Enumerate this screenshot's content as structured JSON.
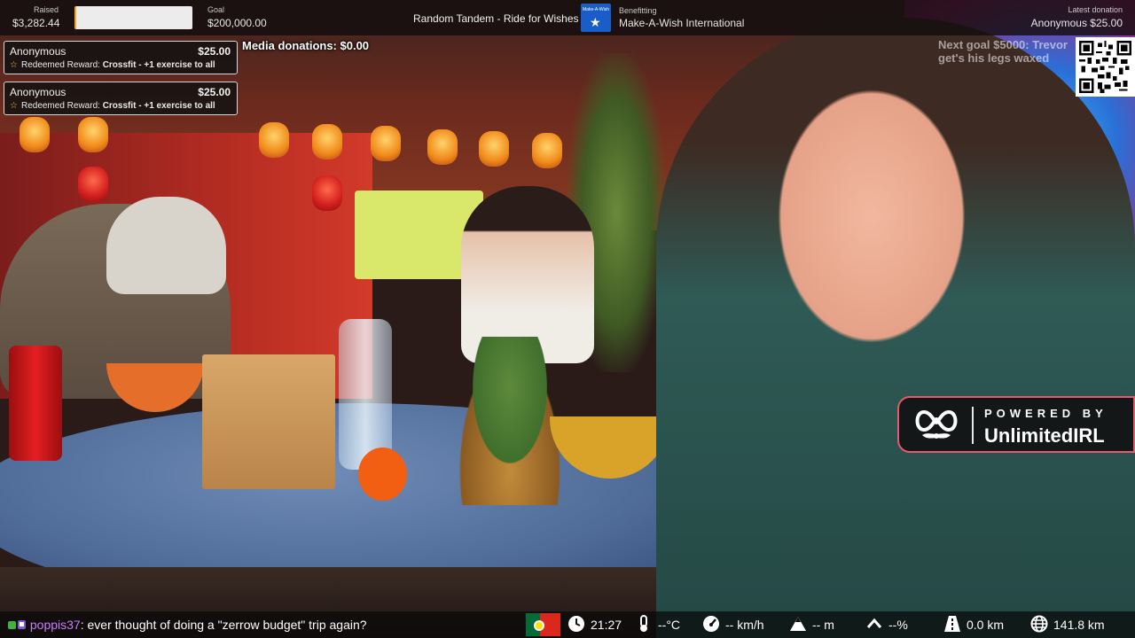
{
  "topbar": {
    "raised_label": "Raised",
    "raised_value": "$3,282.44",
    "progress_fraction": 0.0164,
    "progress_color": "#f5a623",
    "goal_label": "Goal",
    "goal_value": "$200,000.00",
    "event_title": "Random Tandem - Ride for Wishes",
    "charity_logo_text": "Make-A-Wish",
    "benefiting_label": "Benefitting",
    "benefiting_value": "Make-A-Wish International",
    "latest_label": "Latest donation",
    "latest_value": "Anonymous $25.00"
  },
  "alerts": [
    {
      "name": "Anonymous",
      "amount": "$25.00",
      "reward_prefix": "Redeemed Reward:",
      "reward": "Crossfit - +1 exercise to all"
    },
    {
      "name": "Anonymous",
      "amount": "$25.00",
      "reward_prefix": "Redeemed Reward:",
      "reward": "Crossfit - +1 exercise to all"
    }
  ],
  "media_donations": "Media donations: $0.00",
  "next_goal": "Next goal $5000: Trevor get's his legs waxed",
  "powered_by": {
    "label": "POWERED BY",
    "brand": "UnlimitedIRL",
    "border_color": "#e85a6a"
  },
  "chat": {
    "user": "poppis37",
    "separator": ":",
    "message": "ever thought of doing a \"zerrow budget\" trip again?"
  },
  "telemetry": {
    "country_flag": "Portugal",
    "time": "21:27",
    "temperature": "--°C",
    "speed": "-- km/h",
    "altitude": "-- m",
    "incline": "--%",
    "distance": "0.0 km",
    "total_distance": "141.8 km"
  },
  "colors": {
    "chat_username": "#cc7bff",
    "bar_background": "#121010"
  }
}
